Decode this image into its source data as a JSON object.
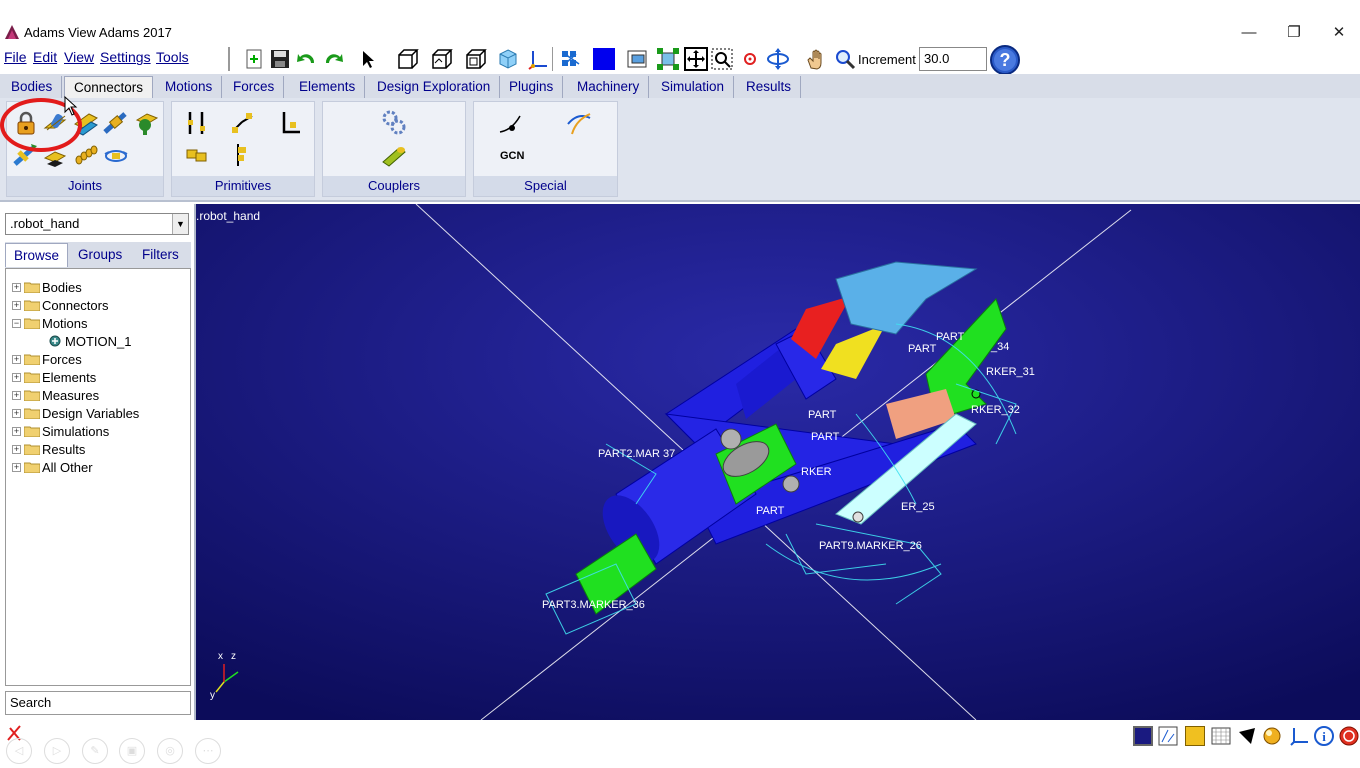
{
  "window": {
    "title": "Adams View Adams 2017",
    "minimize": "—",
    "restore": "❐",
    "close": "✕"
  },
  "menu": [
    "File",
    "Edit",
    "View",
    "Settings",
    "Tools"
  ],
  "toolbar": {
    "increment_label": "Increment",
    "increment_value": "30.0",
    "icons": [
      "new-icon",
      "save-icon",
      "undo-icon",
      "redo-icon",
      "select-icon",
      "view-front-icon",
      "view-top-icon",
      "view-right-icon",
      "view-iso-icon",
      "axes-icon",
      "group-icon",
      "color-icon",
      "render-icon",
      "fit-icon",
      "zoom-box-icon",
      "zoom-window-icon",
      "center-icon",
      "rotate-icon",
      "pan-icon",
      "zoom-icon",
      "help-icon"
    ]
  },
  "tabs": [
    "Bodies",
    "Connectors",
    "Motions",
    "Forces",
    "Elements",
    "Design Exploration",
    "Plugins",
    "Machinery",
    "Simulation",
    "Results"
  ],
  "active_tab": "Connectors",
  "ribbon": {
    "groups": [
      {
        "label": "Joints",
        "icons": [
          "fixed-joint-icon",
          "revolute-joint-icon",
          "translational-joint-icon",
          "cylindrical-joint-icon",
          "spherical-joint-icon",
          "planar-joint-icon",
          "constant-velocity-joint-icon",
          "screw-joint-icon",
          "hooke-joint-icon"
        ]
      },
      {
        "label": "Primitives",
        "icons": [
          "inline-primitive-icon",
          "inplane-primitive-icon",
          "orientation-primitive-icon",
          "parallel-axes-primitive-icon",
          "perpendicular-primitive-icon"
        ]
      },
      {
        "label": "Couplers",
        "icons": [
          "gear-icon",
          "coupler-icon"
        ]
      },
      {
        "label": "Special",
        "icons": [
          "point-curve-icon",
          "curve-curve-icon",
          "general-constraint-icon"
        ],
        "gcn_text": "GCN"
      }
    ]
  },
  "model_selector": ".robot_hand",
  "browser_tabs": [
    "Browse",
    "Groups",
    "Filters"
  ],
  "tree": [
    {
      "label": "Bodies",
      "expanded": false,
      "level": 0
    },
    {
      "label": "Connectors",
      "expanded": false,
      "level": 0
    },
    {
      "label": "Motions",
      "expanded": true,
      "level": 0
    },
    {
      "label": "MOTION_1",
      "expanded": false,
      "level": 1
    },
    {
      "label": "Forces",
      "expanded": false,
      "level": 0
    },
    {
      "label": "Elements",
      "expanded": false,
      "level": 0
    },
    {
      "label": "Measures",
      "expanded": false,
      "level": 0
    },
    {
      "label": "Design Variables",
      "expanded": false,
      "level": 0
    },
    {
      "label": "Simulations",
      "expanded": false,
      "level": 0
    },
    {
      "label": "Results",
      "expanded": false,
      "level": 0
    },
    {
      "label": "All Other",
      "expanded": false,
      "level": 0
    }
  ],
  "search_placeholder": "Search",
  "viewport": {
    "model_label": ".robot_hand",
    "background": "#1c1c8c",
    "labels": [
      "PART2.MAR    37",
      "PART3.MARKER_36",
      "PART9.MARKER_26",
      "ER_25",
      "RKER_32",
      "RKER_31",
      "_34",
      "PART",
      "PART",
      "RKER",
      "PART",
      "PART",
      "PART"
    ],
    "triad": {
      "x": "x",
      "y": "y",
      "z": "z"
    }
  },
  "status_icons": [
    "info-icon",
    "select-filter-icon",
    "icon-settings-icon",
    "grid-icon",
    "color-icon",
    "render-mode-icon",
    "coordinate-icon",
    "info-circle-icon",
    "stop-icon"
  ]
}
